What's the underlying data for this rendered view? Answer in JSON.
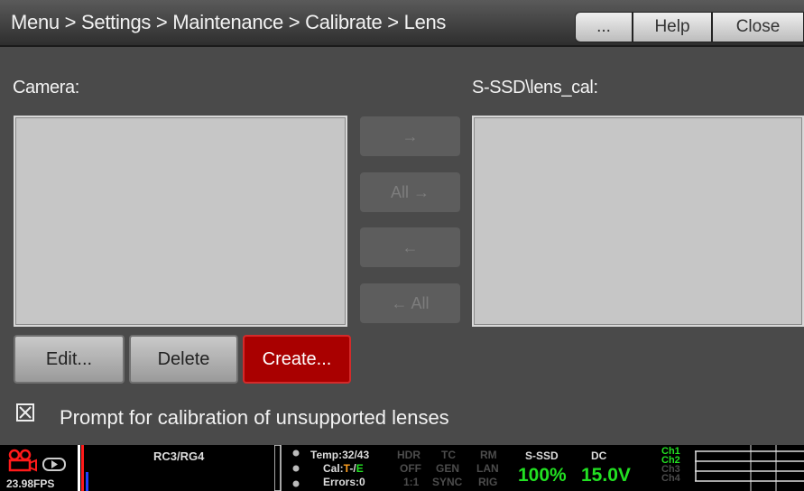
{
  "header": {
    "breadcrumb": "Menu > Settings > Maintenance > Calibrate > Lens",
    "more_label": "...",
    "help_label": "Help",
    "close_label": "Close"
  },
  "camera_list": {
    "label": "Camera:",
    "items": []
  },
  "ssd_list": {
    "label": "S-SSD\\lens_cal:",
    "items": []
  },
  "transfer": {
    "to_right": "→",
    "all_to_right": "All →",
    "to_left": "←",
    "all_to_left": "← All"
  },
  "actions": {
    "edit": "Edit...",
    "delete": "Delete",
    "create": "Create..."
  },
  "prompt_option": {
    "label": "Prompt for calibration of unsupported lenses",
    "checked": true
  },
  "status": {
    "fps": "23.98FPS",
    "color": "RC3/RG4",
    "temp": "Temp:32/43",
    "cal_prefix": "Cal:",
    "cal_t": "T",
    "cal_sep": "-/",
    "cal_e": "E",
    "errors": "Errors:0",
    "hdr": "HDR",
    "hdr_val": "OFF",
    "ratio": "1:1",
    "tc": "TC",
    "gen": "GEN",
    "sync": "SYNC",
    "rm": "RM",
    "lan": "LAN",
    "rig": "RIG",
    "media_label": "S-SSD",
    "media_value": "100%",
    "power_label": "DC",
    "power_value": "15.0V",
    "channels": [
      "Ch1",
      "Ch2",
      "Ch3",
      "Ch4"
    ],
    "colors": {
      "accent_red": "#a90000",
      "status_green": "#22e022",
      "record_red": "#ff1a1a"
    }
  }
}
